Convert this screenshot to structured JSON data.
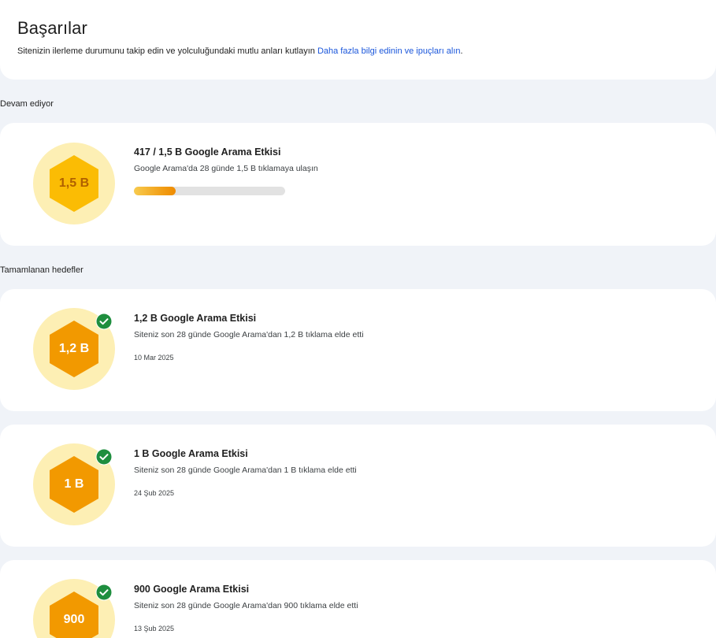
{
  "header": {
    "title": "Başarılar",
    "subtitle_text": "Sitenizin ilerleme durumunu takip edin ve yolculuğundaki mutlu anları kutlayın ",
    "subtitle_link": "Daha fazla bilgi edinin ve ipuçları alın",
    "subtitle_end": "."
  },
  "sections": {
    "in_progress": "Devam ediyor",
    "completed": "Tamamlanan hedefler"
  },
  "in_progress_item": {
    "badge": "1,5 B",
    "title": "417 / 1,5 B Google Arama Etkisi",
    "description": "Google Arama'da 28 günde 1,5 B tıklamaya ulaşın",
    "progress_fraction": 0.278
  },
  "completed_items": [
    {
      "badge": "1,2 B",
      "title": "1,2 B Google Arama Etkisi",
      "description": "Siteniz son 28 günde Google Arama'dan 1,2 B tıklama elde etti",
      "date": "10 Mar 2025"
    },
    {
      "badge": "1 B",
      "title": "1 B Google Arama Etkisi",
      "description": "Siteniz son 28 günde Google Arama'dan 1 B tıklama elde etti",
      "date": "24 Şub 2025"
    },
    {
      "badge": "900",
      "title": "900 Google Arama Etkisi",
      "description": "Siteniz son 28 günde Google Arama'dan 900 tıklama elde etti",
      "date": "13 Şub 2025"
    }
  ],
  "colors": {
    "badge_circle": "#fdefb4",
    "hex_in_progress": "#fbbc04",
    "hex_in_progress_text": "#b06000",
    "hex_completed": "#f29900",
    "hex_completed_text": "#ffffff",
    "check_green": "#1e8e3e",
    "link": "#1a56db"
  },
  "icons": {
    "badge": "hexagon-badge-icon",
    "check": "check-circle-icon"
  }
}
